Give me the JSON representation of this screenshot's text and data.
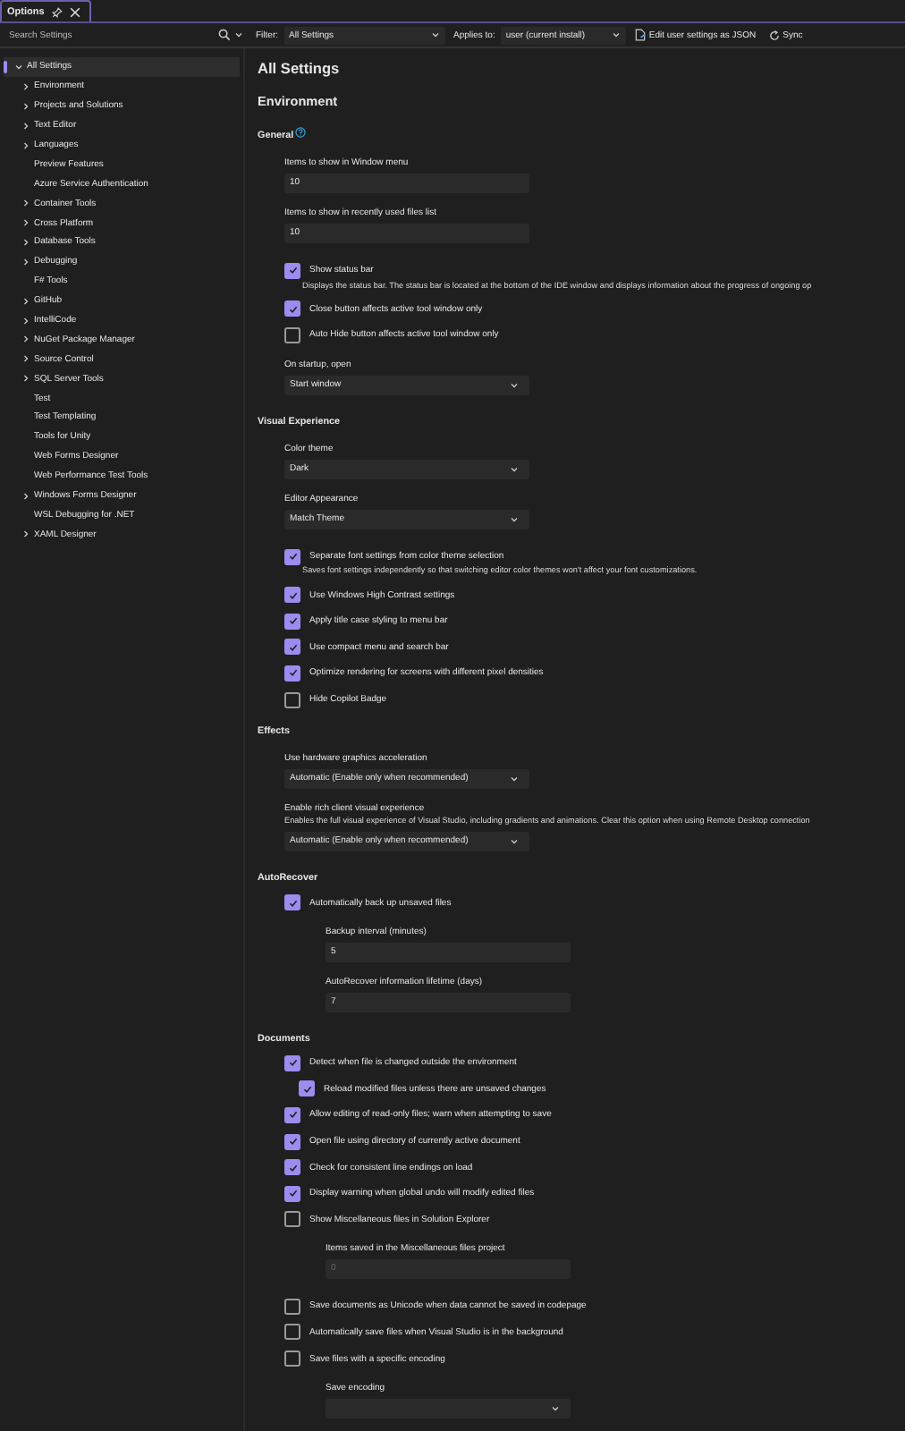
{
  "tab": {
    "title": "Options"
  },
  "toolbar": {
    "search": {
      "placeholder": "Search Settings"
    },
    "filter": {
      "label": "Filter:",
      "value": "All Settings"
    },
    "applies_to": {
      "label": "Applies to:",
      "value": "user (current install)"
    },
    "buttons": [
      {
        "label": "Edit user settings as JSON",
        "kind": "json"
      },
      {
        "label": "Sync",
        "kind": "sync"
      }
    ]
  },
  "sidebar": {
    "items": [
      {
        "label": "All Settings",
        "selected": true,
        "expanded": true,
        "children": [
          {
            "label": "Environment",
            "selected": false,
            "expanded": false
          },
          {
            "label": "Projects and Solutions",
            "selected": false,
            "expanded": false
          },
          {
            "label": "Text Editor",
            "selected": false,
            "expanded": false
          },
          {
            "label": "Languages",
            "selected": false,
            "expanded": false
          },
          {
            "label": "Preview Features",
            "selected": false
          },
          {
            "label": "Azure Service Authentication",
            "selected": false
          },
          {
            "label": "Container Tools",
            "selected": false,
            "expanded": false
          },
          {
            "label": "Cross Platform",
            "selected": false,
            "expanded": false
          },
          {
            "label": "Database Tools",
            "selected": false,
            "expanded": false
          },
          {
            "label": "Debugging",
            "selected": false,
            "expanded": false
          },
          {
            "label": "F# Tools",
            "selected": false
          },
          {
            "label": "GitHub",
            "selected": false,
            "expanded": false
          },
          {
            "label": "IntelliCode",
            "selected": false,
            "expanded": false
          },
          {
            "label": "NuGet Package Manager",
            "selected": false,
            "expanded": false
          },
          {
            "label": "Source Control",
            "selected": false,
            "expanded": false
          },
          {
            "label": "SQL Server Tools",
            "selected": false,
            "expanded": false
          },
          {
            "label": "Test",
            "selected": false
          },
          {
            "label": "Test Templating",
            "selected": false
          },
          {
            "label": "Tools for Unity",
            "selected": false
          },
          {
            "label": "Web Forms Designer",
            "selected": false
          },
          {
            "label": "Web Performance Test Tools",
            "selected": false
          },
          {
            "label": "Windows Forms Designer",
            "selected": false,
            "expanded": false
          },
          {
            "label": "WSL Debugging for .NET",
            "selected": false
          },
          {
            "label": "XAML Designer",
            "selected": false,
            "expanded": false
          }
        ]
      }
    ]
  },
  "page": {
    "title": "All Settings",
    "sections": [
      {
        "title": "Environment",
        "groups": [
          {
            "title": "General",
            "help": true,
            "items": [
              {
                "kind": "text",
                "label": "Items to show in Window menu",
                "value": "10",
                "disabled": false
              },
              {
                "kind": "text",
                "label": "Items to show in recently used files list",
                "value": "10",
                "disabled": false
              },
              {
                "kind": "checkbox",
                "label": "Show status bar",
                "checked": true,
                "description": "Displays the status bar. The status bar is located at the bottom of the IDE window and displays information about the progress of ongoing op"
              },
              {
                "kind": "checkbox",
                "label": "Close button affects active tool window only",
                "checked": true
              },
              {
                "kind": "checkbox",
                "label": "Auto Hide button affects active tool window only",
                "checked": false
              },
              {
                "kind": "select",
                "label": "On startup, open",
                "value": "Start window"
              }
            ]
          },
          {
            "title": "Visual Experience",
            "items": [
              {
                "kind": "select",
                "label": "Color theme",
                "value": "Dark"
              },
              {
                "kind": "select",
                "label": "Editor Appearance",
                "value": "Match Theme"
              },
              {
                "kind": "checkbox",
                "label": "Separate font settings from color theme selection",
                "checked": true,
                "description": "Saves font settings independently so that switching editor color themes won't affect your font customizations."
              },
              {
                "kind": "checkbox",
                "label": "Use Windows High Contrast settings",
                "checked": true
              },
              {
                "kind": "checkbox",
                "label": "Apply title case styling to menu bar",
                "checked": true
              },
              {
                "kind": "checkbox",
                "label": "Use compact menu and search bar",
                "checked": true
              },
              {
                "kind": "checkbox",
                "label": "Optimize rendering for screens with different pixel densities",
                "checked": true
              },
              {
                "kind": "checkbox",
                "label": "Hide Copilot Badge",
                "checked": false
              }
            ]
          },
          {
            "title": "Effects",
            "items": [
              {
                "kind": "select",
                "label": "Use hardware graphics acceleration",
                "value": "Automatic (Enable only when recommended)"
              },
              {
                "kind": "select",
                "label": "Enable rich client visual experience",
                "description": "Enables the full visual experience of Visual Studio, including gradients and animations. Clear this option when using Remote Desktop connection",
                "value": "Automatic (Enable only when recommended)"
              }
            ]
          },
          {
            "title": "AutoRecover",
            "items": [
              {
                "kind": "checkbox",
                "label": "Automatically back up unsaved files",
                "checked": true,
                "children": [
                  {
                    "kind": "text",
                    "label": "Backup interval (minutes)",
                    "value": "5",
                    "disabled": false
                  },
                  {
                    "kind": "text",
                    "label": "AutoRecover information lifetime (days)",
                    "value": "7",
                    "disabled": false
                  }
                ]
              }
            ]
          },
          {
            "title": "Documents",
            "items": [
              {
                "kind": "checkbox",
                "label": "Detect when file is changed outside the environment",
                "checked": true,
                "children": [
                  {
                    "kind": "checkbox",
                    "label": "Reload modified files unless there are unsaved changes",
                    "checked": true
                  }
                ]
              },
              {
                "kind": "checkbox",
                "label": "Allow editing of read-only files; warn when attempting to save",
                "checked": true
              },
              {
                "kind": "checkbox",
                "label": "Open file using directory of currently active document",
                "checked": true
              },
              {
                "kind": "checkbox",
                "label": "Check for consistent line endings on load",
                "checked": true
              },
              {
                "kind": "checkbox",
                "label": "Display warning when global undo will modify edited files",
                "checked": true
              },
              {
                "kind": "checkbox",
                "label": "Show Miscellaneous files in Solution Explorer",
                "checked": false,
                "children": [
                  {
                    "kind": "text",
                    "label": "Items saved in the Miscellaneous files project",
                    "value": "0",
                    "disabled": true
                  }
                ]
              },
              {
                "kind": "checkbox",
                "label": "Save documents as Unicode when data cannot be saved in codepage",
                "checked": false
              },
              {
                "kind": "checkbox",
                "label": "Automatically save files when Visual Studio is in the background",
                "checked": false
              },
              {
                "kind": "checkbox",
                "label": "Save files with a specific encoding",
                "checked": false,
                "children": [
                  {
                    "kind": "select",
                    "label": "Save encoding"
                  }
                ]
              }
            ]
          }
        ]
      }
    ]
  }
}
